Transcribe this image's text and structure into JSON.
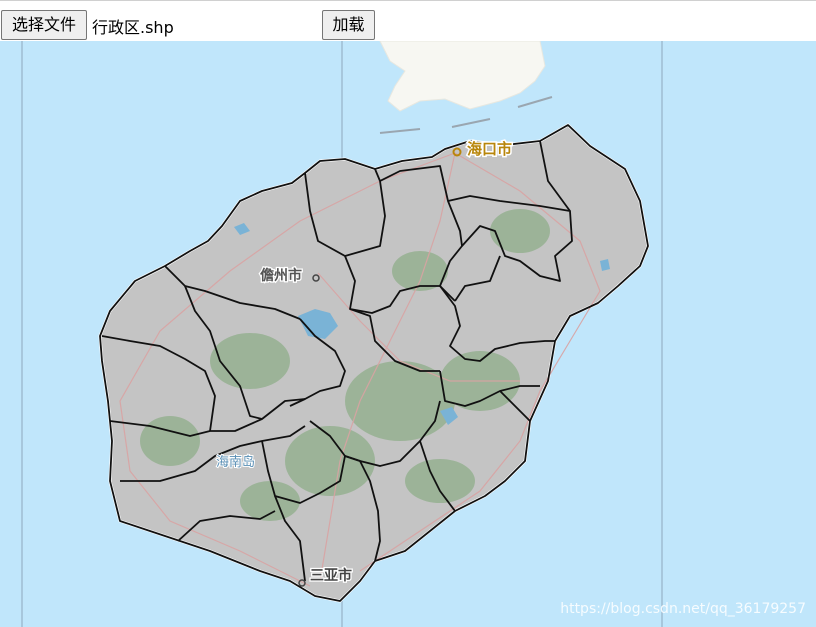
{
  "toolbar": {
    "choose_file_label": "选择文件",
    "file_name": "行政区.shp",
    "load_label": "加载"
  },
  "map": {
    "labels": {
      "haikou": "海口市",
      "danzhou": "儋州市",
      "hainan_island": "海南岛",
      "sanya": "三亚市"
    },
    "watermark": "https://blog.csdn.net/qq_36179257"
  },
  "colors": {
    "sea": "#c0e6fb",
    "land": "#c4c4c4",
    "vegetation": "#8fae8a",
    "boundary": "#111111",
    "road": "#d9a3a3",
    "city_label_highlight": "#b8860b"
  }
}
